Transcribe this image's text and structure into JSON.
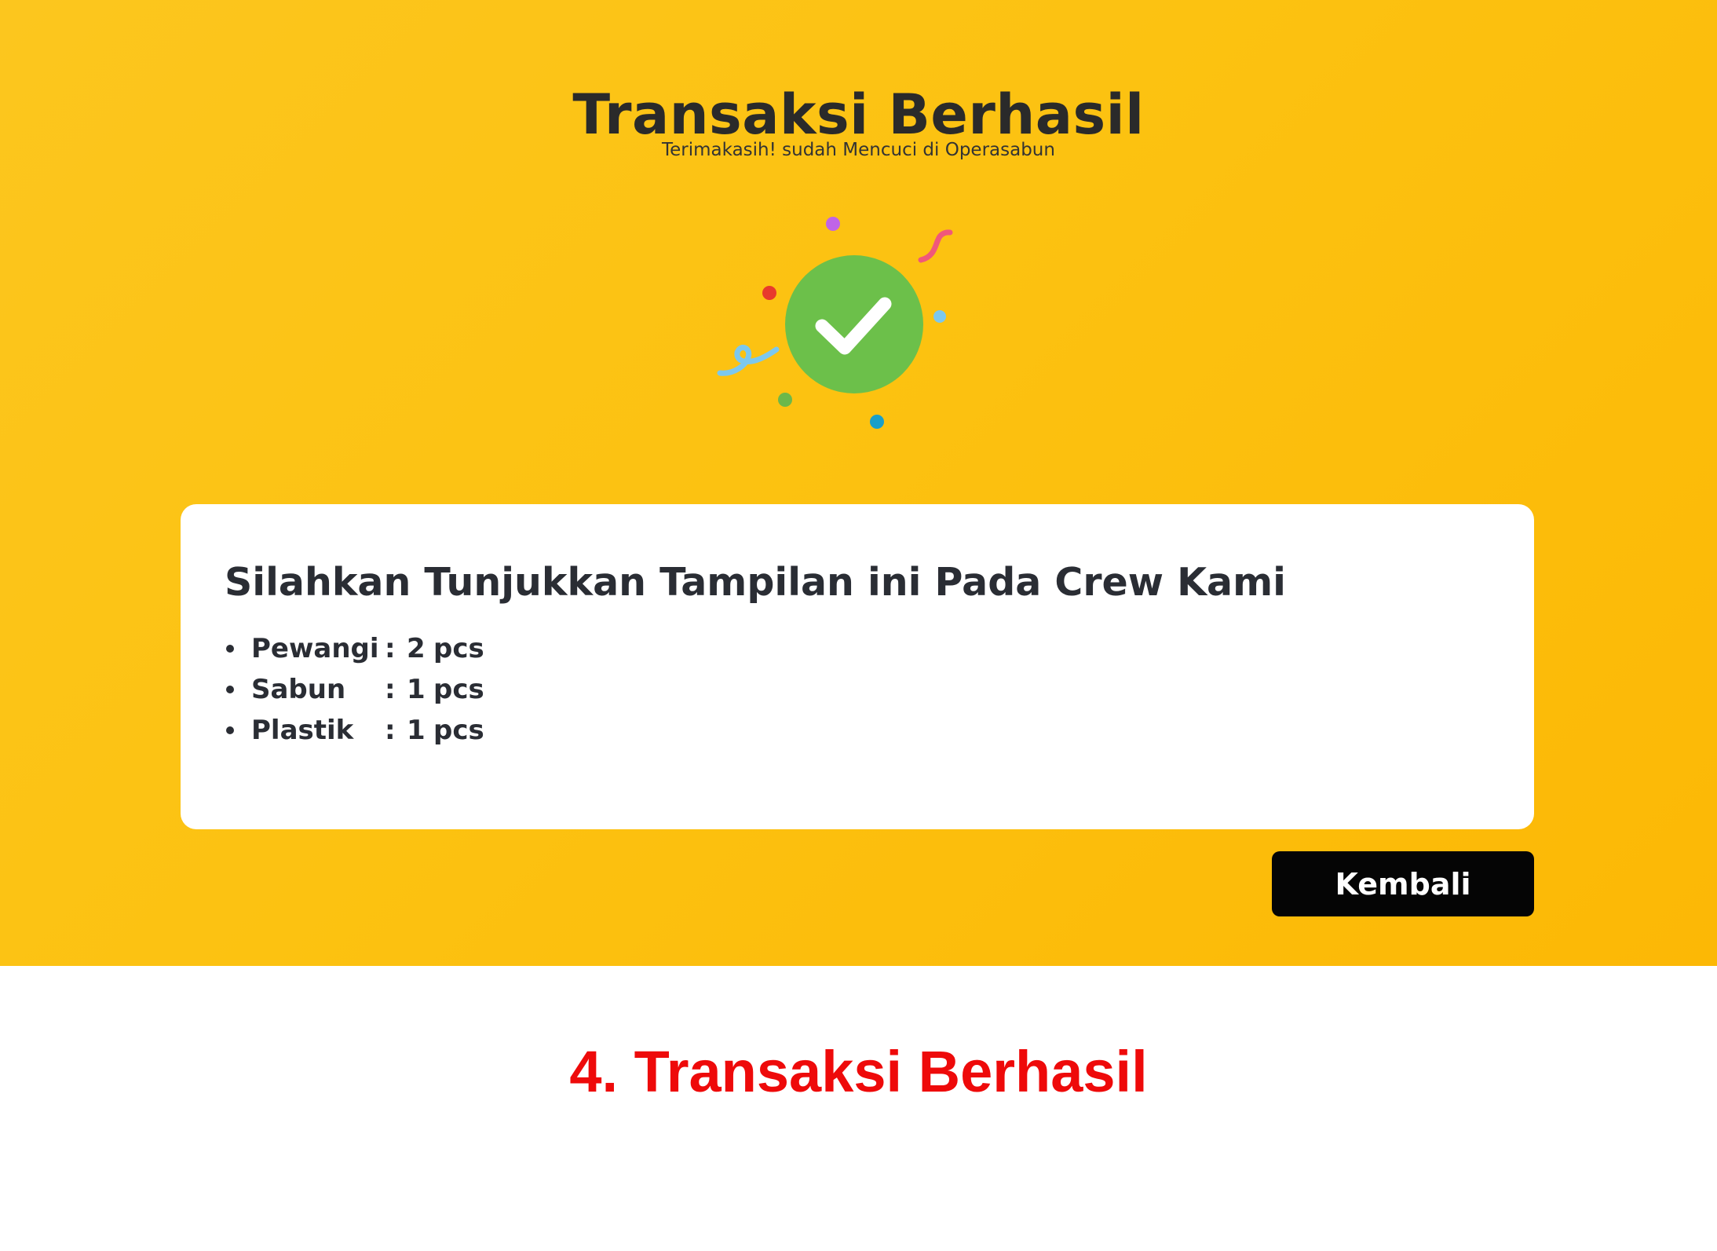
{
  "screen": {
    "title": "Transaksi Berhasil",
    "subtitle": "Terimakasih! sudah Mencuci di Operasabun",
    "icon": "check-circle-icon"
  },
  "card": {
    "heading": "Silahkan Tunjukkan Tampilan ini Pada Crew Kami",
    "items": [
      {
        "name": "Pewangi",
        "separator": ":",
        "qty": "2",
        "unit": "pcs"
      },
      {
        "name": "Sabun",
        "separator": ":",
        "qty": "1",
        "unit": "pcs"
      },
      {
        "name": "Plastik",
        "separator": ":",
        "qty": "1",
        "unit": "pcs"
      }
    ]
  },
  "actions": {
    "back_label": "Kembali"
  },
  "caption": {
    "number": "4.",
    "text": "Transaksi Berhasil"
  },
  "colors": {
    "background_yellow": "#fcc211",
    "success_green": "#6cc04a",
    "button_black": "#050505",
    "caption_red": "#ee0a0a"
  }
}
